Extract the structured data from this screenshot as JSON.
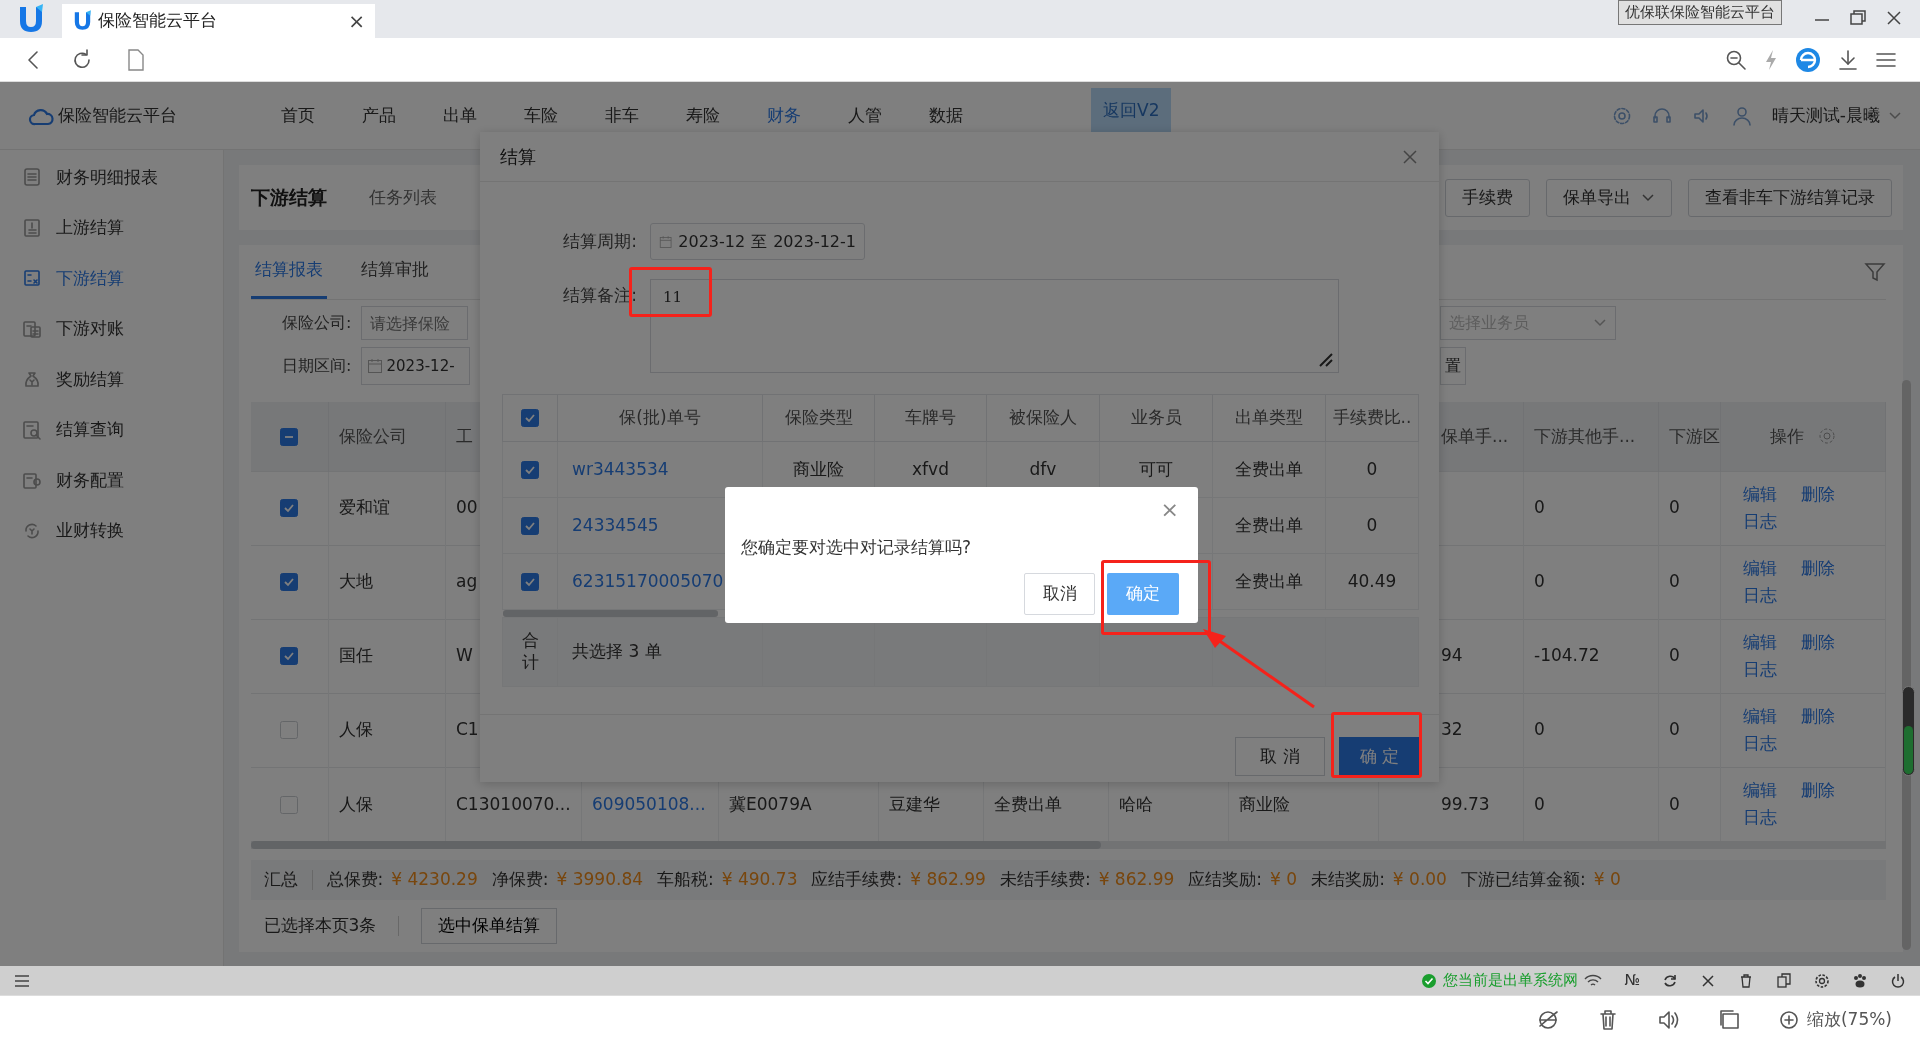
{
  "browser": {
    "tab_title": "保险智能云平台",
    "tab_close": "×",
    "profile_label": "优保联保险智能云平台",
    "zoom_label": "缩放(75%)"
  },
  "app": {
    "brand": "保险智能云平台",
    "back_button": "返回V2",
    "user": "晴天测试-晨曦",
    "nav": [
      {
        "label": "首页",
        "selected": false
      },
      {
        "label": "产品",
        "selected": false
      },
      {
        "label": "出单",
        "selected": false
      },
      {
        "label": "车险",
        "selected": false
      },
      {
        "label": "非车",
        "selected": false
      },
      {
        "label": "寿险",
        "selected": false
      },
      {
        "label": "财务",
        "selected": true
      },
      {
        "label": "人管",
        "selected": false
      },
      {
        "label": "数据",
        "selected": false
      }
    ]
  },
  "sidebar": [
    {
      "label": "财务明细报表",
      "selected": false
    },
    {
      "label": "上游结算",
      "selected": false
    },
    {
      "label": "下游结算",
      "selected": true
    },
    {
      "label": "下游对账",
      "selected": false
    },
    {
      "label": "奖励结算",
      "selected": false
    },
    {
      "label": "结算查询",
      "selected": false
    },
    {
      "label": "财务配置",
      "selected": false
    },
    {
      "label": "业财转换",
      "selected": false
    }
  ],
  "page": {
    "title": "下游结算",
    "task_tab": "任务列表",
    "buttons": [
      {
        "label": "手续费",
        "dropdown": false
      },
      {
        "label": "保单导出",
        "dropdown": true
      },
      {
        "label": "查看非车下游结算记录",
        "dropdown": false
      }
    ]
  },
  "report_tabs": [
    {
      "label": "结算报表",
      "selected": true
    },
    {
      "label": "结算审批",
      "selected": false
    }
  ],
  "filters": {
    "company_label": "保险公司:",
    "company_placeholder": "请选择保险",
    "salesman_placeholder": "选择业务员",
    "button_fragment": "置",
    "date_label": "日期区间:",
    "date_value": "2023-12-"
  },
  "table": {
    "select_all": {
      "indeterminate": true
    },
    "headers": {
      "insurer": "保险公司",
      "column_3": "工",
      "column_10": "保单手...",
      "column_11": "下游其他手...",
      "column_12": "下游区",
      "actions": "操作"
    },
    "rows": [
      {
        "checked": true,
        "cells": {
          "insurer": "爱和谊",
          "column_3": "00",
          "column_11": "0",
          "column_12": "0"
        },
        "actions": [
          "编辑",
          "删除",
          "日志"
        ]
      },
      {
        "checked": true,
        "cells": {
          "insurer": "大地",
          "column_3": "ag",
          "column_11": "0",
          "column_12": "0"
        },
        "actions": [
          "编辑",
          "删除",
          "日志"
        ]
      },
      {
        "checked": true,
        "cells": {
          "insurer": "国任",
          "column_3": "W",
          "column_10": "94",
          "column_11": "-104.72",
          "column_12": "0"
        },
        "actions": [
          "编辑",
          "删除",
          "日志"
        ]
      },
      {
        "checked": false,
        "cells": {
          "insurer": "人保",
          "column_3": "C1",
          "column_10": "32",
          "column_11": "0",
          "column_12": "0"
        },
        "actions": [
          "编辑",
          "删除",
          "日志"
        ]
      },
      {
        "checked": false,
        "cells": {
          "insurer": "人保",
          "column_3": "C13010070...",
          "policy_no": "609050108...",
          "plate": "冀E0079A",
          "insured": "豆建华",
          "issue_type": "全费出单",
          "column_8": "哈哈",
          "insurance_type": "商业险",
          "column_10": "99.73",
          "column_11": "0",
          "column_12": "0"
        },
        "actions": [
          "编辑",
          "删除",
          "日志"
        ]
      }
    ]
  },
  "summary": {
    "label": "汇总",
    "items": [
      {
        "label": "总保费:",
        "value": "¥ 4230.29"
      },
      {
        "label": "净保费:",
        "value": "¥ 3990.84"
      },
      {
        "label": "车船税:",
        "value": "¥ 490.73"
      },
      {
        "label": "应结手续费:",
        "value": "¥ 862.99"
      },
      {
        "label": "未结手续费:",
        "value": "¥ 862.99"
      },
      {
        "label": "应结奖励:",
        "value": "¥ 0"
      },
      {
        "label": "未结奖励:",
        "value": "¥ 0.00"
      },
      {
        "label": "下游已结算金额:",
        "value": "¥ 0"
      }
    ]
  },
  "selection": {
    "text": "已选择本页3条",
    "button": "选中保单结算"
  },
  "modal": {
    "title": "结算",
    "period_label": "结算周期:",
    "period_start": "2023-12",
    "period_sep": "至",
    "period_end": "2023-12-1",
    "note_label": "结算备注:",
    "note_value": "11",
    "table": {
      "header_checked": true,
      "headers": {
        "policy_no": "保(批)单号",
        "insurance_type": "保险类型",
        "plate": "车牌号",
        "insured": "被保险人",
        "salesman": "业务员",
        "issue_type": "出单类型",
        "fee_ratio": "手续费比.."
      },
      "rows": [
        {
          "checked": true,
          "cells": {
            "policy_no": "wr3443534",
            "insurance_type": "商业险",
            "plate": "xfvd",
            "insured": "dfv",
            "salesman": "可可",
            "issue_type": "全费出单",
            "fee_ratio": "0"
          }
        },
        {
          "checked": true,
          "cells": {
            "policy_no": "24334545",
            "issue_type": "全费出单",
            "fee_ratio": "0"
          }
        },
        {
          "checked": true,
          "cells": {
            "policy_no": "62315170005070",
            "issue_type": "全费出单",
            "fee_ratio": "40.49"
          }
        }
      ],
      "total_label": "合计",
      "total_text": "共选择 3 单"
    },
    "cancel": "取 消",
    "confirm": "确 定"
  },
  "confirm_dialog": {
    "close": "×",
    "message": "您确定要对选中对记录结算吗?",
    "cancel": "取消",
    "ok": "确定"
  },
  "status_bar": {
    "network": "您当前是出单系统网",
    "number_sign": "№"
  }
}
